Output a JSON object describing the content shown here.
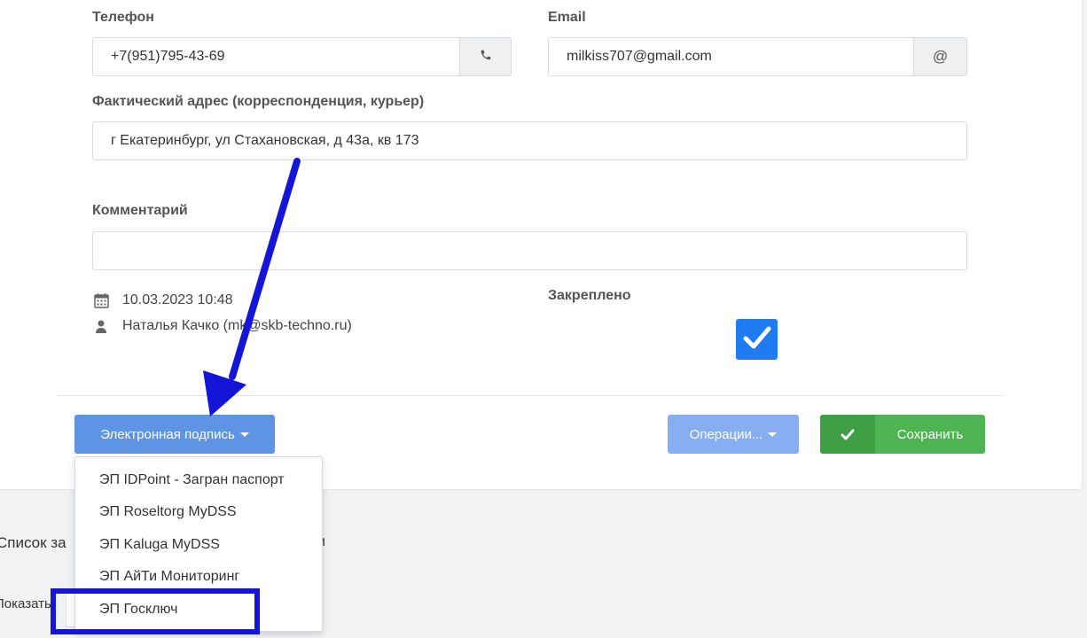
{
  "form": {
    "phone_label": "Телефон",
    "phone_value": "+7(951)795-43-69",
    "email_label": "Email",
    "email_value": "milkiss707@gmail.com",
    "email_addon": "@",
    "address_label": "Фактический адрес (корреспонденция, курьер)",
    "address_value": "г Екатеринбург, ул Стахановская, д 43а, кв 173",
    "comment_label": "Комментарий",
    "comment_value": "",
    "date": "10.03.2023 10:48",
    "author": "Наталья Качко (mk@skb-techno.ru)",
    "pinned_label": "Закреплено",
    "pinned_checked": true
  },
  "buttons": {
    "esig": "Электронная подпись",
    "operations": "Операции...",
    "save": "Сохранить"
  },
  "dropdown": {
    "items": [
      "ЭП IDPoint - Загран паспорт",
      "ЭП Roseltorg MyDSS",
      "ЭП Kaluga MyDSS",
      "ЭП АйТи Мониторинг",
      "ЭП Госключ"
    ]
  },
  "background": {
    "list_title": "Список за",
    "list_title_tail": "и",
    "show_label": "Показать"
  },
  "colors": {
    "primary": "#5f94e4",
    "success": "#4fb453",
    "checkbox": "#1f7bf1",
    "annotation": "#1515d8"
  },
  "icons": {
    "phone": "phone-icon",
    "calendar": "calendar-icon",
    "user": "user-icon",
    "check": "check-icon",
    "caret": "caret-down-icon"
  }
}
